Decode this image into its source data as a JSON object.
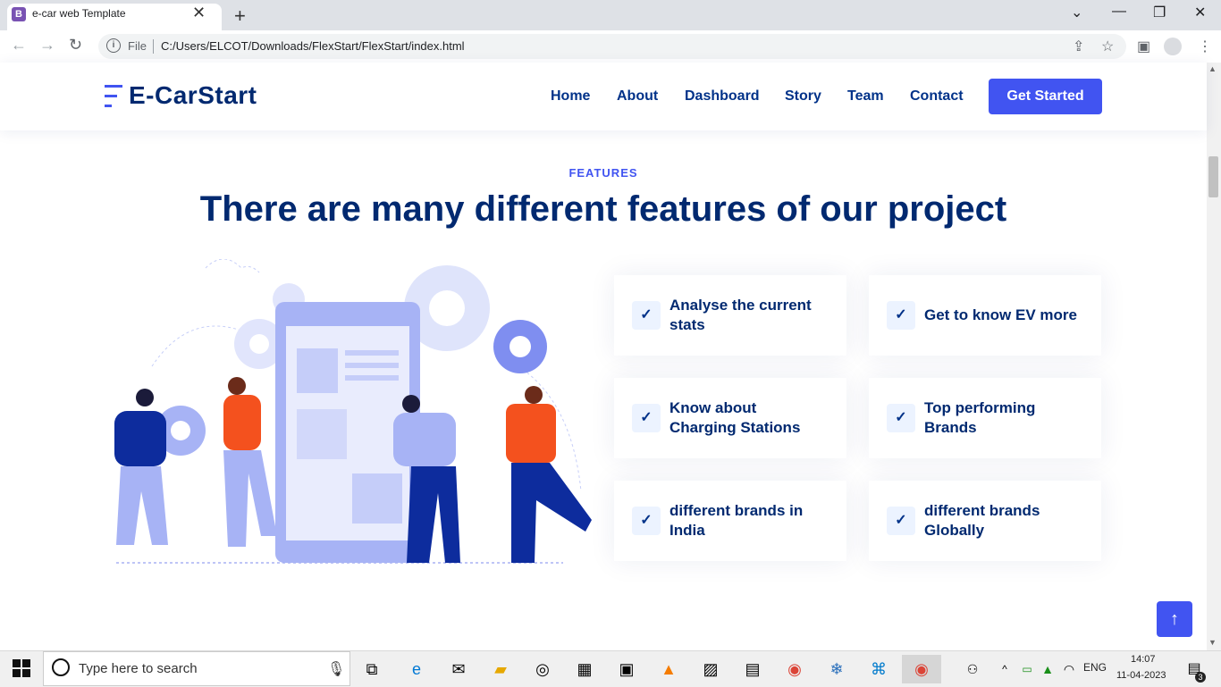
{
  "browser": {
    "tab_title": "e-car web Template",
    "tab_favicon": "B",
    "new_tab_icon": "+",
    "address_prefix": "File",
    "url": "C:/Users/ELCOT/Downloads/FlexStart/FlexStart/index.html"
  },
  "site": {
    "logo": "E-CarStart",
    "nav": [
      "Home",
      "About",
      "Dashboard",
      "Story",
      "Team",
      "Contact"
    ],
    "cta": "Get Started"
  },
  "features": {
    "subtitle": "FEATURES",
    "title": "There are many different features of our project",
    "items": [
      {
        "line1": "Analyse the current",
        "line2": "stats"
      },
      {
        "line1": "Get to know EV more",
        "line2": ""
      },
      {
        "line1": "Know about",
        "line2": "Charging Stations"
      },
      {
        "line1": "Top performing",
        "line2": "Brands"
      },
      {
        "line1": "different brands in",
        "line2": "India"
      },
      {
        "line1": "different brands",
        "line2": "Globally"
      }
    ]
  },
  "taskbar": {
    "search_placeholder": "Type here to search",
    "lang": "ENG",
    "time": "14:07",
    "date": "11-04-2023",
    "notifications": "3"
  },
  "colors": {
    "accent": "#4154f1",
    "heading": "#012970",
    "illustration_orange": "#f4511e",
    "illustration_blue": "#0d2c9d",
    "illustration_light": "#a7b3f5"
  }
}
